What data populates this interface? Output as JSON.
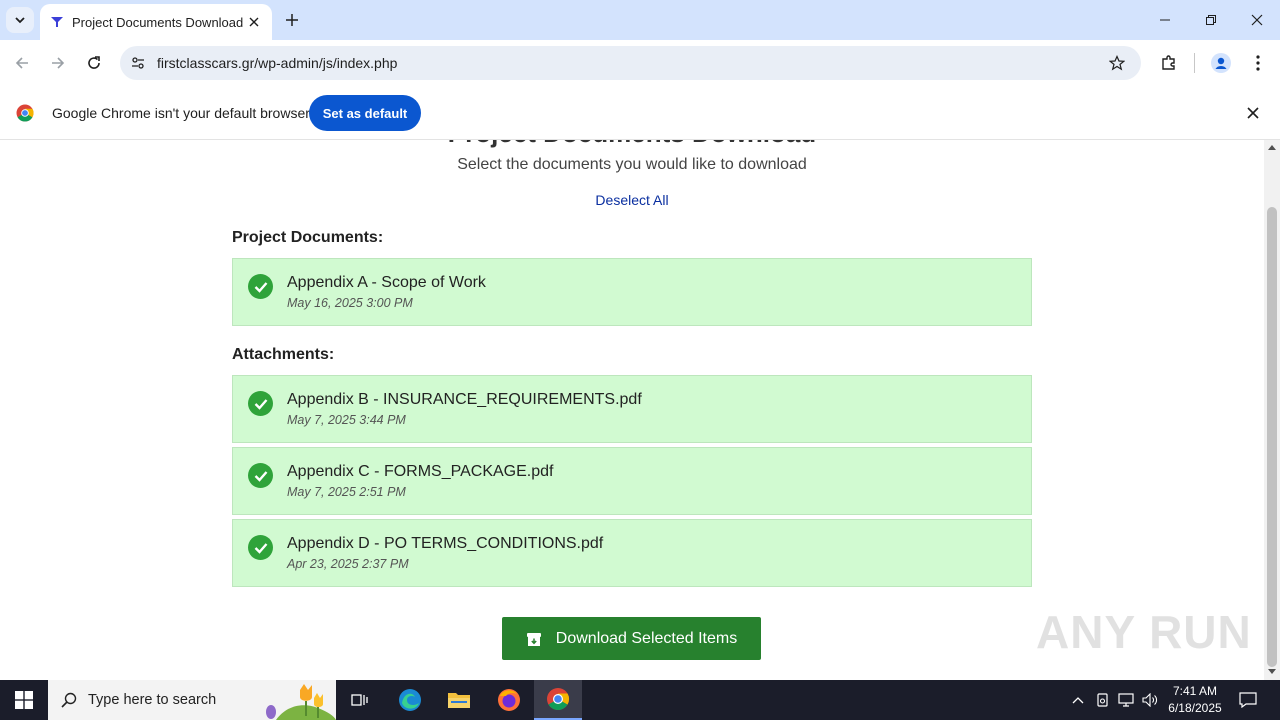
{
  "browser": {
    "tab_title": "Project Documents Download",
    "url": "firstclasscars.gr/wp-admin/js/index.php"
  },
  "infobar": {
    "message": "Google Chrome isn't your default browser",
    "button": "Set as default"
  },
  "page": {
    "title": "Project Documents Download",
    "subtitle": "Select the documents you would like to download",
    "deselect_all": "Deselect All",
    "project_section": "Project Documents:",
    "project_documents": [
      {
        "name": "Appendix A - Scope of Work",
        "date": "May 16, 2025 3:00 PM",
        "selected": true
      }
    ],
    "attachments_section": "Attachments:",
    "attachments": [
      {
        "name": "Appendix B - INSURANCE_REQUIREMENTS.pdf",
        "date": "May 7, 2025 3:44 PM",
        "selected": true
      },
      {
        "name": "Appendix C - FORMS_PACKAGE.pdf",
        "date": "May 7, 2025 2:51 PM",
        "selected": true
      },
      {
        "name": "Appendix D - PO TERMS_CONDITIONS.pdf",
        "date": "Apr 23, 2025 2:37 PM",
        "selected": true
      }
    ],
    "download_button": "Download Selected Items"
  },
  "watermark": "ANY RUN",
  "taskbar": {
    "search_placeholder": "Type here to search",
    "time": "7:41 AM",
    "date": "6/18/2025"
  },
  "colors": {
    "doc_bg": "#d1fad1",
    "check": "#2fa33a",
    "download_btn": "#27812e",
    "chrome_blue": "#0b57d0"
  }
}
